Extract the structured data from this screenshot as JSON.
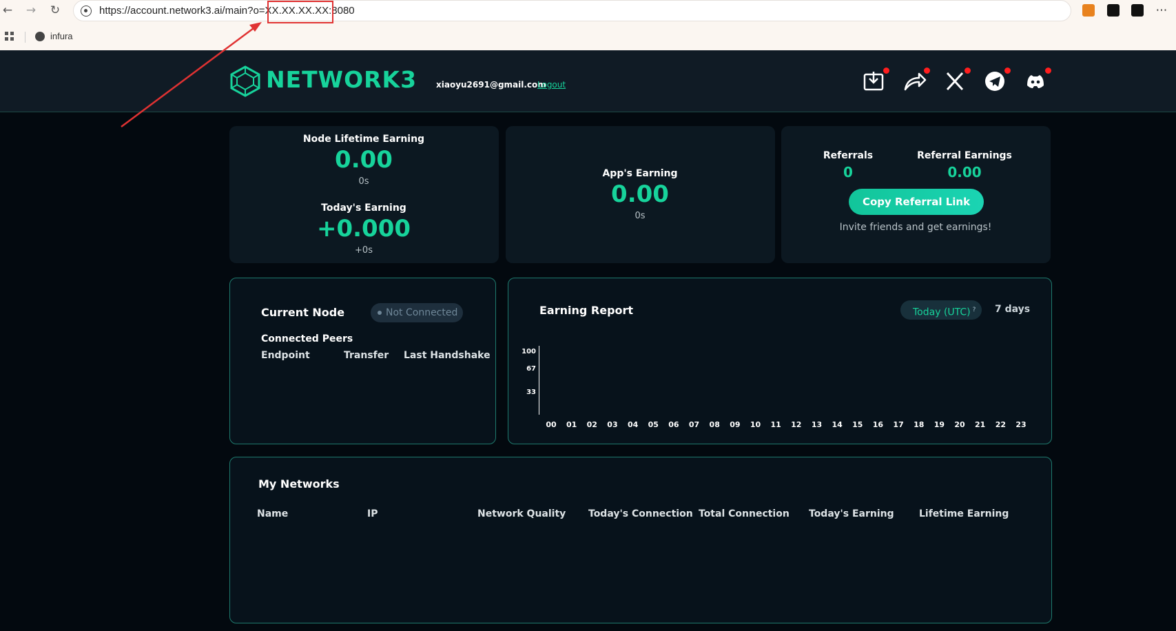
{
  "browser": {
    "url": "https://account.network3.ai/main?o=XX.XX.XX.XX:8080",
    "bookmark": "infura"
  },
  "header": {
    "brand": "NETWORK3",
    "email": "xiaoyu2691@gmail.com",
    "logout": "Logout"
  },
  "earnings": {
    "lifetime_label": "Node Lifetime Earning",
    "lifetime_value": "0.00",
    "lifetime_time": "0s",
    "today_label": "Today's Earning",
    "today_value": "+0.000",
    "today_time": "+0s"
  },
  "app_earning": {
    "label": "App's Earning",
    "value": "0.00",
    "time": "0s"
  },
  "referral": {
    "referrals_label": "Referrals",
    "referrals_value": "0",
    "earnings_label": "Referral Earnings",
    "earnings_value": "0.00",
    "copy_button": "Copy Referral Link",
    "invite_text": "Invite friends and get earnings!"
  },
  "current_node": {
    "title": "Current Node",
    "status": "Not Connected",
    "peers_label": "Connected Peers",
    "columns": [
      "Endpoint",
      "Transfer",
      "Last Handshake"
    ]
  },
  "earning_report": {
    "title": "Earning Report",
    "range_today": "Today (UTC)",
    "range_today_hint": "?",
    "range_7days": "7 days"
  },
  "chart_data": {
    "type": "bar",
    "categories": [
      "00",
      "01",
      "02",
      "03",
      "04",
      "05",
      "06",
      "07",
      "08",
      "09",
      "10",
      "11",
      "12",
      "13",
      "14",
      "15",
      "16",
      "17",
      "18",
      "19",
      "20",
      "21",
      "22",
      "23"
    ],
    "values": [],
    "y_ticks": [
      "100",
      "67",
      "33"
    ],
    "ylim": [
      0,
      100
    ],
    "grid": false
  },
  "my_networks": {
    "title": "My Networks",
    "columns": [
      "Name",
      "IP",
      "Network Quality",
      "Today's Connection",
      "Total Connection",
      "Today's Earning",
      "Lifetime Earning"
    ]
  },
  "colors": {
    "accent": "#17d39b",
    "background": "#03090f",
    "card": "#0c1821",
    "annotation": "#e03232"
  },
  "icons": {
    "social": [
      "download-icon",
      "share-icon",
      "x-icon",
      "telegram-icon",
      "discord-icon"
    ]
  }
}
